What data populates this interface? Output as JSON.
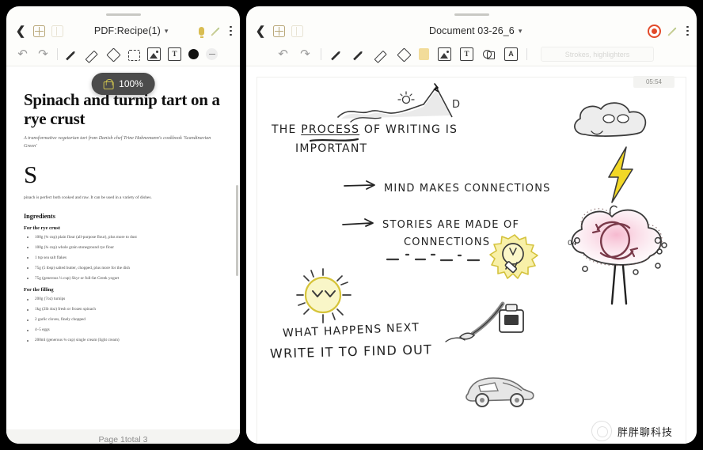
{
  "left_panel": {
    "header": {
      "back_icon": "chevron-left-icon",
      "grid_view_icon": "grid-view-icon",
      "page_view_icon": "page-view-icon",
      "title": "PDF:Recipe(1)",
      "title_chevron": "⌄",
      "mic_icon": "microphone-icon",
      "pen_icon": "pen-icon",
      "menu_icon": "kebab-menu-icon"
    },
    "toolbar": {
      "undo": "↶",
      "redo": "↷",
      "tools": [
        "pen-tool",
        "highlighter-tool",
        "eraser-tool",
        "shape-tool",
        "image-tool",
        "text-tool"
      ],
      "color_swatch": "#111111",
      "minus_label": "−"
    },
    "zoom_pill": {
      "lock_icon": "lock-open-icon",
      "value": "100%"
    },
    "document": {
      "title": "Spinach and turnip tart on a rye crust",
      "subtitle": "A transformative vegetarian tart from Danish chef Trine Hahnemann's cookbook 'Scandinavian Green'",
      "dropcap": "S",
      "body": "pinach is perfect both cooked and raw. It can be used in a variety of dishes.",
      "ingredients_heading": "Ingredients",
      "sections": [
        {
          "heading": "For the rye crust",
          "items": [
            "100g (¾ cup) plain flour (all-purpose flour), plus more to dust",
            "100g (¾ cup) whole grain stoneground rye flour",
            "1 tsp sea salt flakes",
            "75g (5 tbsp) salted butter, chopped, plus more for the dish",
            "75g (generous ¼ cup) Skyr or full-fat Greek yogurt"
          ]
        },
        {
          "heading": "For the filling",
          "items": [
            "200g (7oz) turnips",
            "1kg (2lb 4oz) fresh or frozen spinach",
            "2 garlic cloves, finely chopped",
            "4–5 eggs",
            "200ml (generous ¾ cup) single cream (light cream)"
          ]
        }
      ],
      "footer": "Page 1total 3"
    }
  },
  "right_panel": {
    "header": {
      "back_icon": "chevron-left-icon",
      "grid_view_icon": "grid-view-icon",
      "page_view_icon": "page-view-icon",
      "title": "Document 03-26_6",
      "title_chevron": "⌄",
      "record_icon": "record-target-icon",
      "pen_icon": "pen-icon",
      "menu_icon": "kebab-menu-icon"
    },
    "toolbar": {
      "undo": "↶",
      "redo": "↷",
      "tools": [
        "pencil-tool",
        "pen-tool",
        "highlighter-tool",
        "eraser-tool",
        "color-swatch-tool",
        "image-tool",
        "text-tool",
        "lasso-tool",
        "text-recognition-tool"
      ],
      "search_field_text": "Strokes, highlighters"
    },
    "canvas": {
      "timestamp": "05:54",
      "handwriting": [
        {
          "id": "line-1",
          "text": "THE PROCESS OF WRITING IS"
        },
        {
          "id": "line-2",
          "text": "IMPORTANT"
        },
        {
          "id": "line-3",
          "text": "MIND MAKES CONNECTIONS"
        },
        {
          "id": "line-4",
          "text": "STORIES ARE MADE OF"
        },
        {
          "id": "line-5",
          "text": "CONNECTIONS"
        },
        {
          "id": "line-6",
          "text": "WHAT HAPPENS NEXT"
        },
        {
          "id": "line-7",
          "text": "WRITE IT TO FIND OUT"
        }
      ],
      "sketches": [
        "landscape-mountain-sketch",
        "sun-with-face-sketch",
        "lightbulb-sketch",
        "dashed-line-sketch",
        "storm-cloud-sketch",
        "lightning-bolt-sketch",
        "pink-cloud-cycle-sketch",
        "pen-and-inkwell-sketch",
        "car-sketch"
      ]
    },
    "watermark": {
      "logo": "channel-logo-icon",
      "text": "胖胖聊科技"
    }
  },
  "colors": {
    "accent_yellow": "#d9bd52",
    "record_red": "#e24a2a",
    "pill_dark": "#4b4b4b",
    "highlight_pink": "#f5c6d8"
  }
}
